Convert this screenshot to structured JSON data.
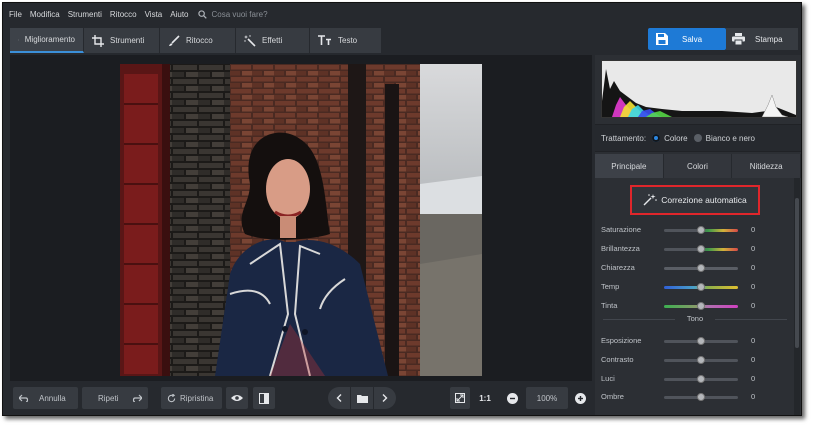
{
  "menu": [
    "File",
    "Modifica",
    "Strumenti",
    "Ritocco",
    "Vista",
    "Aiuto"
  ],
  "search": {
    "placeholder": "Cosa vuoi fare?"
  },
  "tabs": [
    {
      "label": "Miglioramento",
      "icon": "sliders-icon",
      "active": true
    },
    {
      "label": "Strumenti",
      "icon": "crop-icon"
    },
    {
      "label": "Ritocco",
      "icon": "brush-icon"
    },
    {
      "label": "Effetti",
      "icon": "magic-wand-icon"
    },
    {
      "label": "Testo",
      "icon": "text-icon"
    }
  ],
  "actions": {
    "save": "Salva",
    "print": "Stampa"
  },
  "bottom": {
    "undo": "Annulla",
    "redo": "Ripeti",
    "reset": "Ripristina",
    "ratio": "1:1",
    "zoom": "100%"
  },
  "trattamento": {
    "label": "Trattamento:",
    "options": [
      {
        "label": "Colore",
        "selected": true
      },
      {
        "label": "Bianco e nero",
        "selected": false
      }
    ]
  },
  "subtabs": [
    {
      "label": "Principale",
      "active": true
    },
    {
      "label": "Colori"
    },
    {
      "label": "Nitidezza"
    }
  ],
  "auto_correction": "Correzione automatica",
  "sliders_top": [
    {
      "label": "Saturazione",
      "value": "0",
      "track": "saturation"
    },
    {
      "label": "Brillantezza",
      "value": "0",
      "track": "vibrance"
    },
    {
      "label": "Chiarezza",
      "value": "0",
      "track": "gray"
    },
    {
      "label": "Temp",
      "value": "0",
      "track": "temperature"
    },
    {
      "label": "Tinta",
      "value": "0",
      "track": "tint"
    }
  ],
  "section_tono": "Tono",
  "sliders_tone": [
    {
      "label": "Esposizione",
      "value": "0"
    },
    {
      "label": "Contrasto",
      "value": "0"
    },
    {
      "label": "Luci",
      "value": "0"
    },
    {
      "label": "Ombre",
      "value": "0"
    }
  ],
  "colors": {
    "accent": "#1e7ad6",
    "highlight_border": "#e0262b"
  }
}
